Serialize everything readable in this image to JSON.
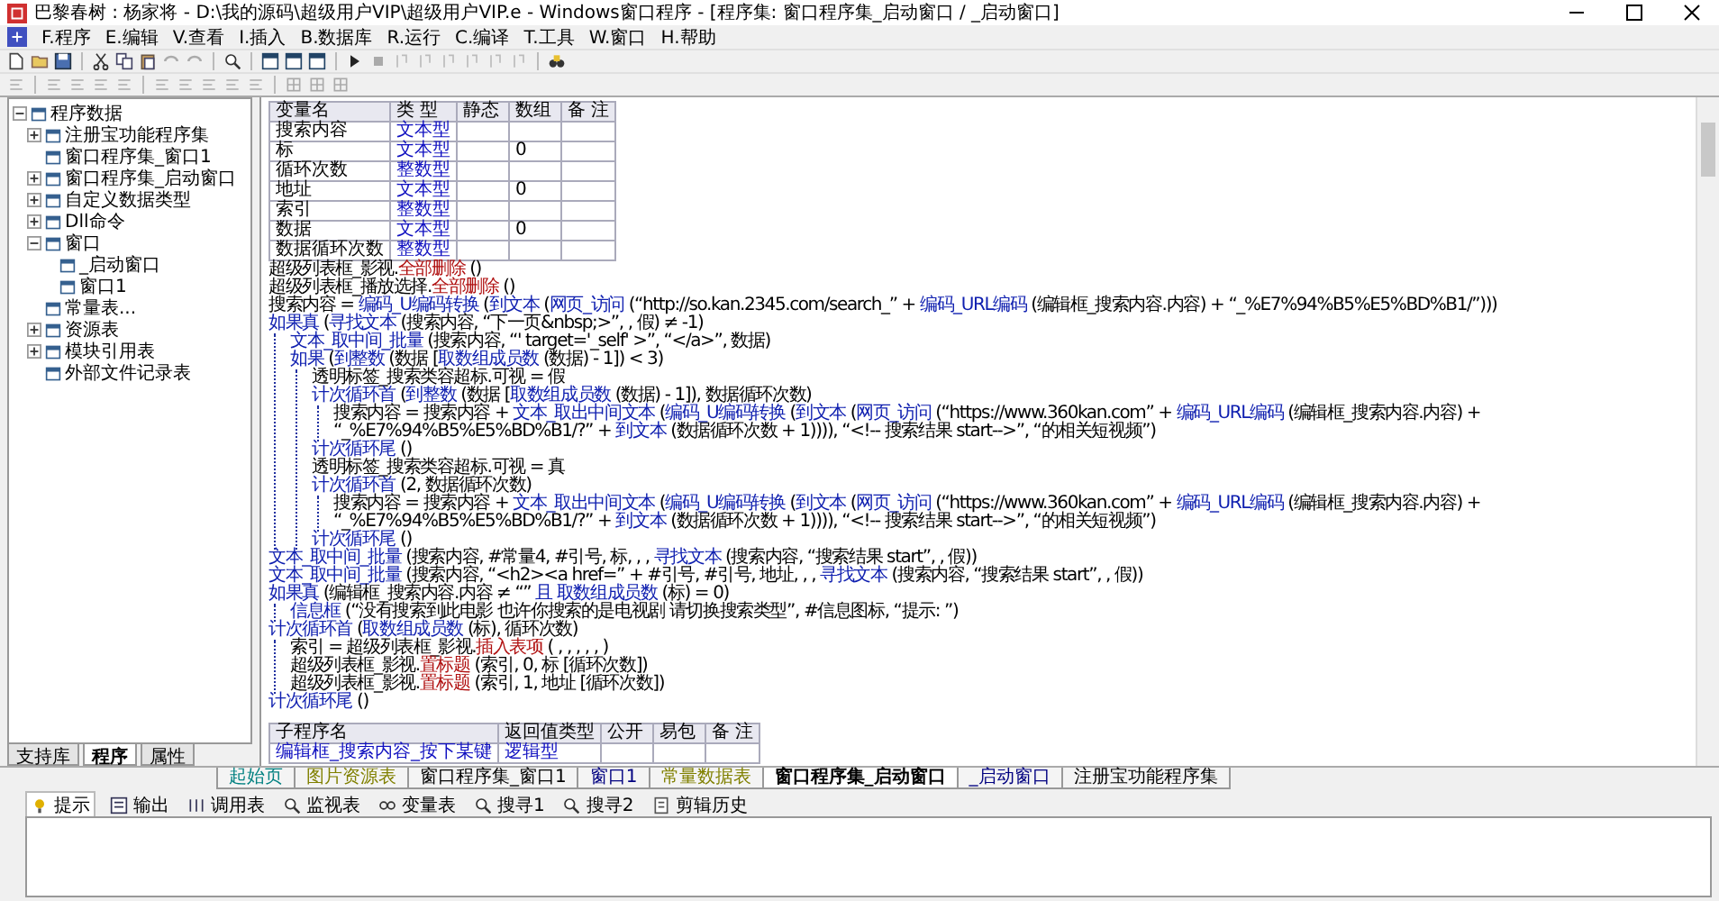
{
  "window": {
    "title": "巴黎春树 : 杨家将 - D:\\我的源码\\超级用户VIP\\超级用户VIP.e - Windows窗口程序 - [程序集: 窗口程序集_启动窗口 / _启动窗口]"
  },
  "menu": [
    "F.程序",
    "E.编辑",
    "V.查看",
    "I.插入",
    "B.数据库",
    "R.运行",
    "C.编译",
    "T.工具",
    "W.窗口",
    "H.帮助"
  ],
  "tree": {
    "label": "程序数据",
    "expanded": true,
    "children": [
      {
        "label": "注册宝功能程序集",
        "expanded": false
      },
      {
        "label": "窗口程序集_窗口1"
      },
      {
        "label": "窗口程序集_启动窗口",
        "expanded": false
      },
      {
        "label": "自定义数据类型",
        "expanded": false
      },
      {
        "label": "Dll命令",
        "expanded": false
      },
      {
        "label": "窗口",
        "expanded": true,
        "children": [
          {
            "label": "_启动窗口"
          },
          {
            "label": "窗口1"
          }
        ]
      },
      {
        "label": "常量表..."
      },
      {
        "label": "资源表",
        "expanded": false
      },
      {
        "label": "模块引用表",
        "expanded": false
      },
      {
        "label": "外部文件记录表"
      }
    ]
  },
  "left_tabs": [
    {
      "label": "支持库",
      "selected": false
    },
    {
      "label": "程序",
      "selected": true
    },
    {
      "label": "属性",
      "selected": false
    }
  ],
  "variable_table": {
    "columns": [
      "变量名",
      "类 型",
      "静态",
      "数组",
      "备 注"
    ],
    "rows": [
      [
        "搜索内容",
        "文本型",
        "",
        "",
        ""
      ],
      [
        "标",
        "文本型",
        "",
        "0",
        ""
      ],
      [
        "循环次数",
        "整数型",
        "",
        "",
        ""
      ],
      [
        "地址",
        "文本型",
        "",
        "0",
        ""
      ],
      [
        "索引",
        "整数型",
        "",
        "",
        ""
      ],
      [
        "数据",
        "文本型",
        "",
        "0",
        ""
      ],
      [
        "数据循环次数",
        "整数型",
        "",
        "",
        ""
      ]
    ]
  },
  "code_lines": [
    {
      "parts": [
        {
          "kind": "text",
          "text": "超级列表框_影视."
        },
        {
          "kind": "method",
          "text": "全部删除"
        },
        {
          "kind": "text",
          "text": " ()"
        }
      ]
    },
    {
      "parts": [
        {
          "kind": "text",
          "text": "超级列表框_播放选择."
        },
        {
          "kind": "method",
          "text": "全部删除"
        },
        {
          "kind": "text",
          "text": " ()"
        }
      ]
    },
    {
      "parts": [
        {
          "kind": "text",
          "text": "搜索内容 = "
        },
        {
          "kind": "call",
          "text": "编码_U编码转换"
        },
        {
          "kind": "text",
          "text": " ("
        },
        {
          "kind": "call",
          "text": "到文本"
        },
        {
          "kind": "text",
          "text": " ("
        },
        {
          "kind": "call",
          "text": "网页_访问"
        },
        {
          "kind": "text",
          "text": " (“http://so.kan.2345.com/search_” + "
        },
        {
          "kind": "call",
          "text": "编码_URL编码"
        },
        {
          "kind": "text",
          "text": " (编辑框_搜索内容.内容) + “_%E7%94%B5%E5%BD%B1/”)))"
        }
      ]
    },
    {
      "parts": [
        {
          "kind": "call",
          "text": "如果真"
        },
        {
          "kind": "text",
          "text": " ("
        },
        {
          "kind": "call",
          "text": "寻找文本"
        },
        {
          "kind": "text",
          "text": " (搜索内容, “下一页&nbsp;>”, , 假) ≠ -1)"
        }
      ],
      "children": [
        {
          "parts": [
            {
              "kind": "call",
              "text": "文本_取中间_批量"
            },
            {
              "kind": "text",
              "text": " (搜索内容, “' target='_self' >”, “</a>”, 数据)"
            }
          ]
        },
        {
          "parts": [
            {
              "kind": "call",
              "text": "如果"
            },
            {
              "kind": "text",
              "text": " ("
            },
            {
              "kind": "call",
              "text": "到整数"
            },
            {
              "kind": "text",
              "text": " (数据 ["
            },
            {
              "kind": "call",
              "text": "取数组成员数"
            },
            {
              "kind": "text",
              "text": " (数据) - 1]) < 3)"
            }
          ],
          "children": [
            {
              "parts": [
                {
                  "kind": "text",
                  "text": "透明标签_搜索类容超标.可视 = 假"
                }
              ]
            },
            {
              "parts": [
                {
                  "kind": "call",
                  "text": "计次循环首"
                },
                {
                  "kind": "text",
                  "text": " ("
                },
                {
                  "kind": "call",
                  "text": "到整数"
                },
                {
                  "kind": "text",
                  "text": " (数据 ["
                },
                {
                  "kind": "call",
                  "text": "取数组成员数"
                },
                {
                  "kind": "text",
                  "text": " (数据) - 1]), 数据循环次数)"
                }
              ],
              "children": [
                {
                  "parts": [
                    {
                      "kind": "text",
                      "text": "搜索内容 = 搜索内容 + "
                    },
                    {
                      "kind": "call",
                      "text": "文本_取出中间文本"
                    },
                    {
                      "kind": "text",
                      "text": " ("
                    },
                    {
                      "kind": "call",
                      "text": "编码_U编码转换"
                    },
                    {
                      "kind": "text",
                      "text": " ("
                    },
                    {
                      "kind": "call",
                      "text": "到文本"
                    },
                    {
                      "kind": "text",
                      "text": " ("
                    },
                    {
                      "kind": "call",
                      "text": "网页_访问"
                    },
                    {
                      "kind": "text",
                      "text": " (“https://www.360kan.com” + "
                    },
                    {
                      "kind": "call",
                      "text": "编码_URL编码"
                    },
                    {
                      "kind": "text",
                      "text": " (编辑框_搜索内容.内容) + “_%E7%94%B5%E5%BD%B1/?” + "
                    },
                    {
                      "kind": "call",
                      "text": "到文本"
                    },
                    {
                      "kind": "text",
                      "text": " (数据循环次数 + 1)))), “<!-- 搜索结果 start-->”, “的相关短视频”)"
                    }
                  ]
                }
              ]
            },
            {
              "parts": [
                {
                  "kind": "call",
                  "text": "计次循环尾"
                },
                {
                  "kind": "text",
                  "text": " ()"
                }
              ]
            },
            {
              "parts": [
                {
                  "kind": "text",
                  "text": "透明标签_搜索类容超标.可视 = 真"
                }
              ]
            },
            {
              "parts": [
                {
                  "kind": "call",
                  "text": "计次循环首"
                },
                {
                  "kind": "text",
                  "text": " (2, 数据循环次数)"
                }
              ],
              "children": [
                {
                  "parts": [
                    {
                      "kind": "text",
                      "text": "搜索内容 = 搜索内容 + "
                    },
                    {
                      "kind": "call",
                      "text": "文本_取出中间文本"
                    },
                    {
                      "kind": "text",
                      "text": " ("
                    },
                    {
                      "kind": "call",
                      "text": "编码_U编码转换"
                    },
                    {
                      "kind": "text",
                      "text": " ("
                    },
                    {
                      "kind": "call",
                      "text": "到文本"
                    },
                    {
                      "kind": "text",
                      "text": " ("
                    },
                    {
                      "kind": "call",
                      "text": "网页_访问"
                    },
                    {
                      "kind": "text",
                      "text": " (“https://www.360kan.com” + "
                    },
                    {
                      "kind": "call",
                      "text": "编码_URL编码"
                    },
                    {
                      "kind": "text",
                      "text": " (编辑框_搜索内容.内容) + “_%E7%94%B5%E5%BD%B1/?” + "
                    },
                    {
                      "kind": "call",
                      "text": "到文本"
                    },
                    {
                      "kind": "text",
                      "text": " (数据循环次数 + 1)))), “<!-- 搜索结果 start-->”, “的相关短视频”)"
                    }
                  ]
                }
              ]
            },
            {
              "parts": [
                {
                  "kind": "call",
                  "text": "计次循环尾"
                },
                {
                  "kind": "text",
                  "text": " ()"
                }
              ]
            }
          ]
        }
      ]
    },
    {
      "parts": [
        {
          "kind": "call",
          "text": "文本_取中间_批量"
        },
        {
          "kind": "text",
          "text": " (搜索内容, #常量4, #引号, 标, , , "
        },
        {
          "kind": "call",
          "text": "寻找文本"
        },
        {
          "kind": "text",
          "text": " (搜索内容, “搜索结果 start”, , 假))"
        }
      ]
    },
    {
      "parts": [
        {
          "kind": "call",
          "text": "文本_取中间_批量"
        },
        {
          "kind": "text",
          "text": " (搜索内容, “<h2><a href=” + #引号, #引号, 地址, , , "
        },
        {
          "kind": "call",
          "text": "寻找文本"
        },
        {
          "kind": "text",
          "text": " (搜索内容, “搜索结果 start”, , 假))"
        }
      ]
    },
    {
      "parts": [
        {
          "kind": "call",
          "text": "如果真"
        },
        {
          "kind": "text",
          "text": " (编辑框_搜索内容.内容 ≠ “” "
        },
        {
          "kind": "call",
          "text": "且 取数组成员数"
        },
        {
          "kind": "text",
          "text": " (标) = 0)"
        }
      ],
      "children": [
        {
          "parts": [
            {
              "kind": "call",
              "text": "信息框"
            },
            {
              "kind": "text",
              "text": " (“没有搜索到此电影  也许你搜索的是电视剧 请切换搜索类型”, #信息图标, “提示: ”)"
            }
          ]
        }
      ]
    },
    {
      "parts": [
        {
          "kind": "call",
          "text": "计次循环首"
        },
        {
          "kind": "text",
          "text": " ("
        },
        {
          "kind": "call",
          "text": "取数组成员数"
        },
        {
          "kind": "text",
          "text": " (标), 循环次数)"
        }
      ],
      "children": [
        {
          "parts": [
            {
              "kind": "text",
              "text": "索引 = 超级列表框_影视."
            },
            {
              "kind": "method",
              "text": "插入表项"
            },
            {
              "kind": "text",
              "text": " ( , , , , , )"
            }
          ]
        },
        {
          "parts": [
            {
              "kind": "text",
              "text": "超级列表框_影视."
            },
            {
              "kind": "method",
              "text": "置标题"
            },
            {
              "kind": "text",
              "text": " (索引, 0, 标 [循环次数])"
            }
          ]
        },
        {
          "parts": [
            {
              "kind": "text",
              "text": "超级列表框_影视."
            },
            {
              "kind": "method",
              "text": "置标题"
            },
            {
              "kind": "text",
              "text": " (索引, 1, 地址 [循环次数])"
            }
          ]
        }
      ]
    },
    {
      "parts": [
        {
          "kind": "call",
          "text": "计次循环尾"
        },
        {
          "kind": "text",
          "text": " ()"
        }
      ]
    }
  ],
  "sub_table": {
    "columns": [
      "子程序名",
      "返回值类型",
      "公开",
      "易包",
      "备 注"
    ],
    "rows": [
      [
        "编辑框_搜索内容_按下某键",
        "逻辑型",
        "",
        "",
        ""
      ]
    ]
  },
  "editor_tabs": [
    {
      "label": "起始页",
      "selected": false,
      "color": "#008080"
    },
    {
      "label": "图片资源表",
      "selected": false,
      "color": "#808000"
    },
    {
      "label": "窗口程序集_窗口1",
      "selected": false,
      "color": "#000000"
    },
    {
      "label": "窗口1",
      "selected": false,
      "color": "#000080"
    },
    {
      "label": "常量数据表",
      "selected": false,
      "color": "#808000"
    },
    {
      "label": "窗口程序集_启动窗口",
      "selected": true,
      "color": "#000000"
    },
    {
      "label": "_启动窗口",
      "selected": false,
      "color": "#000080"
    },
    {
      "label": "注册宝功能程序集",
      "selected": false,
      "color": "#000000"
    }
  ],
  "output_tabs": [
    {
      "label": "提示",
      "selected": true
    },
    {
      "label": "输出",
      "selected": false
    },
    {
      "label": "调用表",
      "selected": false
    },
    {
      "label": "监视表",
      "selected": false
    },
    {
      "label": "变量表",
      "selected": false
    },
    {
      "label": "搜寻1",
      "selected": false
    },
    {
      "label": "搜寻2",
      "selected": false
    },
    {
      "label": "剪辑历史",
      "selected": false
    }
  ]
}
